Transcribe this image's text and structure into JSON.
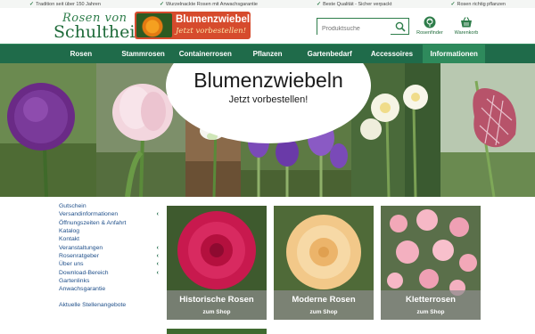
{
  "topbar": {
    "items": [
      "Tradition seit über 150 Jahren",
      "Wurzelnackte Rosen mit Anwachsgarantie",
      "Beste Qualität - Sicher verpackt",
      "Rosen richtig pflanzen"
    ]
  },
  "header": {
    "logo_line1": "Rosen von",
    "logo_line2": "Schultheis",
    "promo_title": "Blumenzwiebeln",
    "promo_sub": "Jetzt vorbestellen!",
    "search_placeholder": "Produktsuche",
    "rosenfinder_label": "Rosenfinder",
    "warenkorb_label": "Warenkorb"
  },
  "nav": {
    "items": [
      "Rosen",
      "Stammrosen",
      "Containerrosen",
      "Pflanzen",
      "Gartenbedarf",
      "Accessoires",
      "Informationen"
    ],
    "active_index": 6
  },
  "hero": {
    "title": "Blumenzwiebeln",
    "subtitle": "Jetzt vorbestellen!"
  },
  "sidebar": {
    "items": [
      {
        "label": "Gutschein",
        "expandable": false
      },
      {
        "label": "Versandinformationen",
        "expandable": true
      },
      {
        "label": "Öffnungszeiten & Anfahrt",
        "expandable": false
      },
      {
        "label": "Katalog",
        "expandable": false
      },
      {
        "label": "Kontakt",
        "expandable": false
      },
      {
        "label": "Veranstaltungen",
        "expandable": true
      },
      {
        "label": "Rosenratgeber",
        "expandable": true
      },
      {
        "label": "Über uns",
        "expandable": true
      },
      {
        "label": "Download-Bereich",
        "expandable": true
      },
      {
        "label": "Gartenlinks",
        "expandable": false
      },
      {
        "label": "Anwachsgarantie",
        "expandable": false
      }
    ],
    "extra": "Aktuelle Stellenangebote"
  },
  "tiles": [
    {
      "title": "Historische Rosen",
      "cta": "zum Shop"
    },
    {
      "title": "Moderne Rosen",
      "cta": "zum Shop"
    },
    {
      "title": "Kletterrosen",
      "cta": "zum Shop"
    }
  ],
  "colors": {
    "brand_green": "#1f6b4a",
    "nav_active": "#2e8a5c",
    "promo_red": "#d64b2d",
    "link_blue": "#1f4f8a"
  }
}
